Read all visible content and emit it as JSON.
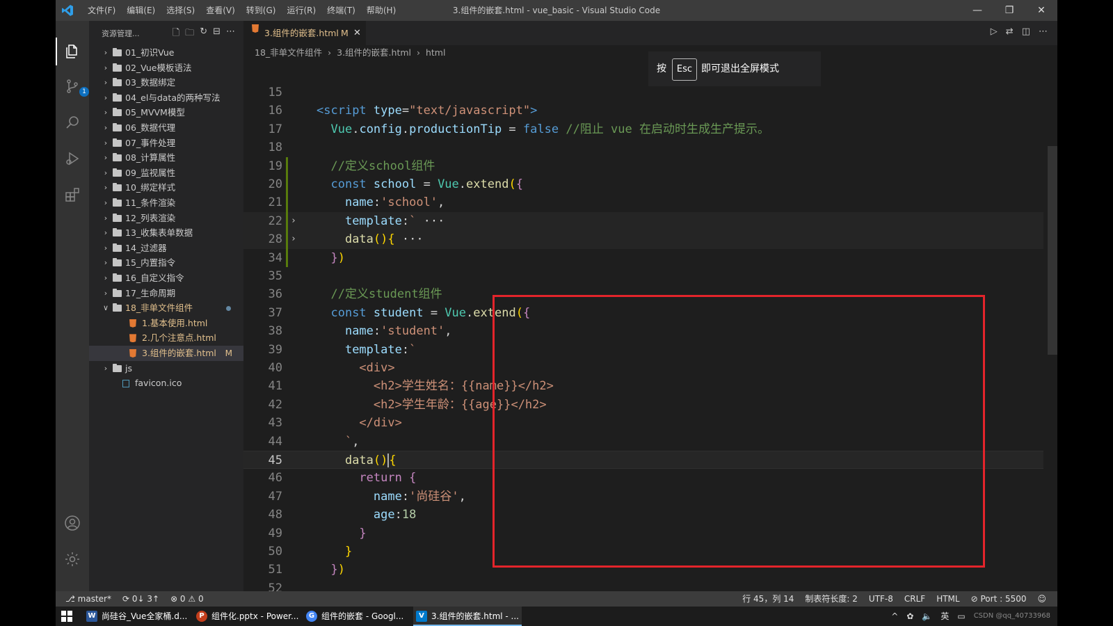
{
  "window": {
    "title": "3.组件的嵌套.html - vue_basic - Visual Studio Code",
    "menu": [
      "文件(F)",
      "编辑(E)",
      "选择(S)",
      "查看(V)",
      "转到(G)",
      "运行(R)",
      "终端(T)",
      "帮助(H)"
    ],
    "controls": [
      "—",
      "❐",
      "✕"
    ]
  },
  "activity_bar": {
    "items": [
      "explorer-icon",
      "source-control-icon",
      "search-icon",
      "run-debug-icon",
      "extensions-icon"
    ],
    "source_control_badge": "1",
    "bottom": [
      "account-icon",
      "settings-gear-icon"
    ]
  },
  "sidebar": {
    "title": "资源管理...",
    "tree": [
      {
        "label": "01_初识Vue",
        "type": "folder"
      },
      {
        "label": "02_Vue模板语法",
        "type": "folder"
      },
      {
        "label": "03_数据绑定",
        "type": "folder"
      },
      {
        "label": "04_el与data的两种写法",
        "type": "folder"
      },
      {
        "label": "05_MVVM模型",
        "type": "folder"
      },
      {
        "label": "06_数据代理",
        "type": "folder"
      },
      {
        "label": "07_事件处理",
        "type": "folder"
      },
      {
        "label": "08_计算属性",
        "type": "folder"
      },
      {
        "label": "09_监视属性",
        "type": "folder"
      },
      {
        "label": "10_绑定样式",
        "type": "folder"
      },
      {
        "label": "11_条件渲染",
        "type": "folder"
      },
      {
        "label": "12_列表渲染",
        "type": "folder"
      },
      {
        "label": "13_收集表单数据",
        "type": "folder"
      },
      {
        "label": "14_过滤器",
        "type": "folder"
      },
      {
        "label": "15_内置指令",
        "type": "folder"
      },
      {
        "label": "16_自定义指令",
        "type": "folder"
      },
      {
        "label": "17_生命周期",
        "type": "folder"
      },
      {
        "label": "18_非单文件组件",
        "type": "folder-open"
      },
      {
        "label": "1.基本使用.html",
        "type": "file"
      },
      {
        "label": "2.几个注意点.html",
        "type": "file"
      },
      {
        "label": "3.组件的嵌套.html",
        "type": "file",
        "modified": "M"
      },
      {
        "label": "js",
        "type": "folder"
      },
      {
        "label": "favicon.ico",
        "type": "ico"
      }
    ]
  },
  "editor": {
    "tab": {
      "label": "3.组件的嵌套.html",
      "modified": "M",
      "close": "✕"
    },
    "breadcrumb": [
      "18_非单文件组件",
      "3.组件的嵌套.html",
      "html"
    ],
    "fullscreen_hint": {
      "prefix": "按",
      "key": "Esc",
      "suffix": "即可退出全屏模式"
    },
    "current_line": 45,
    "lines": [
      {
        "n": "15",
        "html": ""
      },
      {
        "n": "16",
        "html": "<span class='tag'>&lt;</span><span class='tagn'>script</span> <span class='attr'>type</span>=<span class='str'>\"text/javascript\"</span><span class='tag'>&gt;</span>"
      },
      {
        "n": "17",
        "html": "  <span class='obj'>Vue</span>.<span class='prop'>config</span>.<span class='prop'>productionTip</span> = <span class='kw'>false</span> <span class='cm'>//阻止 vue 在启动时生成生产提示。</span>"
      },
      {
        "n": "18",
        "html": ""
      },
      {
        "n": "19",
        "html": "  <span class='cm'>//定义school组件</span>"
      },
      {
        "n": "20",
        "html": "  <span class='kw'>const</span> <span class='prop'>school</span> = <span class='obj'>Vue</span>.<span class='fn'>extend</span><span class='y'>(</span><span class='kc'>{</span>"
      },
      {
        "n": "21",
        "html": "    <span class='prop'>name</span>:<span class='str'>'school'</span>,"
      },
      {
        "n": "22",
        "html": "    <span class='prop'>template</span>:<span class='str'>`</span> <span class='punc'>···</span>"
      },
      {
        "n": "28",
        "html": "    <span class='fn'>data</span><span class='y'>()</span><span class='y'>{</span> <span class='punc'>···</span>"
      },
      {
        "n": "34",
        "html": "  <span class='kc'>}</span><span class='y'>)</span>"
      },
      {
        "n": "35",
        "html": ""
      },
      {
        "n": "36",
        "html": "  <span class='cm'>//定义student组件</span>"
      },
      {
        "n": "37",
        "html": "  <span class='kw'>const</span> <span class='prop'>student</span> = <span class='obj'>Vue</span>.<span class='fn'>extend</span><span class='y'>(</span><span class='kc'>{</span>"
      },
      {
        "n": "38",
        "html": "    <span class='prop'>name</span>:<span class='str'>'student'</span>,"
      },
      {
        "n": "39",
        "html": "    <span class='prop'>template</span>:<span class='str'>`</span>"
      },
      {
        "n": "40",
        "html": "<span class='str'>      &lt;div&gt;</span>"
      },
      {
        "n": "41",
        "html": "<span class='str'>        &lt;h2&gt;学生姓名：{{name}}&lt;/h2&gt;</span>"
      },
      {
        "n": "42",
        "html": "<span class='str'>        &lt;h2&gt;学生年龄：{{age}}&lt;/h2&gt;</span>"
      },
      {
        "n": "43",
        "html": "<span class='str'>      &lt;/div&gt;</span>"
      },
      {
        "n": "44",
        "html": "<span class='str'>    `</span>,"
      },
      {
        "n": "45",
        "html": "    <span class='fn'>data</span><span class='y'>()</span><span class='cursor-caret'></span><span class='y'>{</span>"
      },
      {
        "n": "46",
        "html": "      <span class='kc'>return</span> <span class='kc'>{</span>"
      },
      {
        "n": "47",
        "html": "        <span class='prop'>name</span>:<span class='str'>'尚硅谷'</span>,"
      },
      {
        "n": "48",
        "html": "        <span class='prop'>age</span>:<span class='num'>18</span>"
      },
      {
        "n": "49",
        "html": "      <span class='kc'>}</span>"
      },
      {
        "n": "50",
        "html": "    <span class='y'>}</span>"
      },
      {
        "n": "51",
        "html": "  <span class='kc'>}</span><span class='y'>)</span>"
      },
      {
        "n": "52",
        "html": ""
      }
    ]
  },
  "ime_toolbar": {
    "lang": "英"
  },
  "statusbar": {
    "branch": "master*",
    "sync": "0↓ 3↑",
    "problems": "⊗ 0  ⚠ 0",
    "position": "行 45，列 14",
    "tab_size": "制表符长度: 2",
    "encoding": "UTF-8",
    "eol": "CRLF",
    "language": "HTML",
    "port": "Port : 5500"
  },
  "taskbar": {
    "items": [
      {
        "label": "尚硅谷_Vue全家桶.d...",
        "icon": "W",
        "color": "#2b579a"
      },
      {
        "label": "组件化.pptx - Power...",
        "icon": "P",
        "color": "#c43e1c"
      },
      {
        "label": "组件的嵌套 - Googl...",
        "icon": "G",
        "color": "#4285f4"
      },
      {
        "label": "3.组件的嵌套.html - ...",
        "icon": "V",
        "color": "#007acc"
      }
    ],
    "tray_lang": "英",
    "watermark": "CSDN @qq_40733968"
  }
}
